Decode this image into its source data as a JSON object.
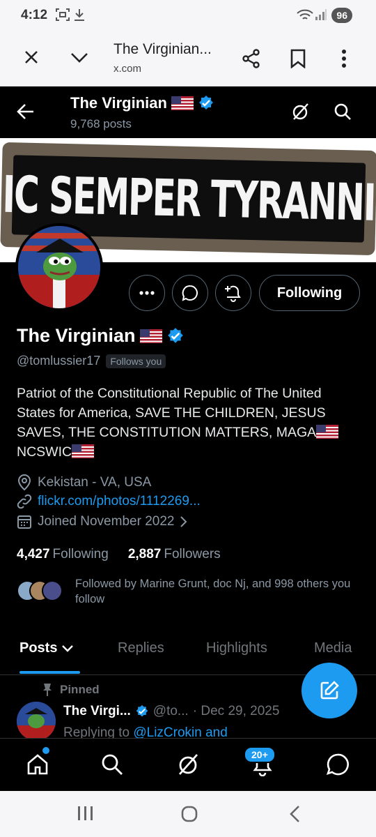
{
  "status_bar": {
    "time": "4:12",
    "battery": "96"
  },
  "browser": {
    "title": "The Virginian...",
    "url": "x.com"
  },
  "header": {
    "name": "The Virginian",
    "posts": "9,768 posts"
  },
  "banner": {
    "text": "SIC SEMPER TYRANNIS"
  },
  "actions": {
    "follow_label": "Following"
  },
  "profile": {
    "name": "The Virginian",
    "handle": "@tomlussier17",
    "follows_you": "Follows you",
    "bio_line1": "Patriot of the Constitutional Republic of The United States for America, SAVE THE CHILDREN, JESUS SAVES, THE CONSTITUTION MATTERS, MAGA",
    "bio_mid": "NCSWIC",
    "location": "Kekistan - VA, USA",
    "website": "flickr.com/photos/1112269...",
    "joined": "Joined November 2022"
  },
  "stats": {
    "following_count": "4,427",
    "following_label": "Following",
    "followers_count": "2,887",
    "followers_label": "Followers"
  },
  "followed_by": "Followed by Marine Grunt, doc Nj, and 998 others you follow",
  "tabs": [
    "Posts",
    "Replies",
    "Highlights",
    "Media"
  ],
  "pinned_tweet": {
    "pinned_label": "Pinned",
    "author": "The Virgi...",
    "handle": "@to...",
    "date": "· Dec 29, 2025",
    "reply_prefix": "Replying to",
    "reply_to": "@LizCrokin and"
  },
  "bottom_nav": {
    "notification_badge": "20+"
  },
  "colors": {
    "accent": "#1d9bf0",
    "verified": "#1d9bf0",
    "background": "#000000",
    "muted": "#8b98a5"
  }
}
